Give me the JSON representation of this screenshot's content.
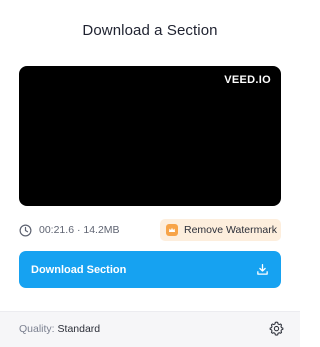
{
  "dialog": {
    "title": "Download a Section"
  },
  "preview": {
    "watermark": "VEED.IO"
  },
  "meta": {
    "duration_size": "00:21.6 · 14.2MB",
    "remove_watermark_label": "Remove Watermark"
  },
  "download_button": {
    "label": "Download Section"
  },
  "footer": {
    "quality_label": "Quality:",
    "quality_value": "Standard"
  },
  "icons": {
    "duration": "clock-icon",
    "premium": "crown-icon",
    "download": "download-icon",
    "settings": "gear-icon"
  },
  "colors": {
    "accent": "#16a2f1",
    "badge_bg": "#fdeedd",
    "badge_icon": "#f7a449"
  }
}
